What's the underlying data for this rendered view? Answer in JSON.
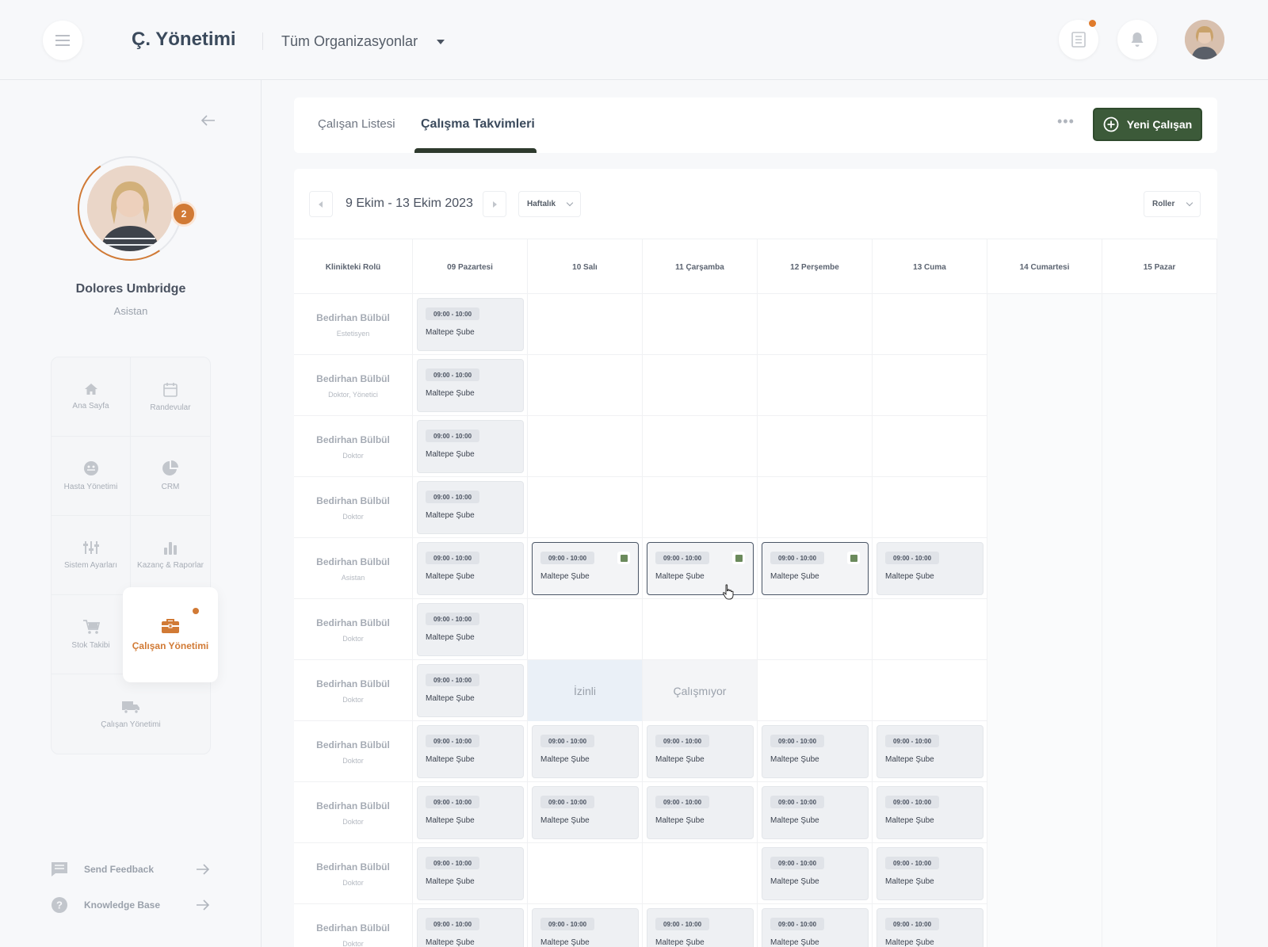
{
  "header": {
    "brand": "Ç. Yönetimi",
    "org": "Tüm Organizasyonlar"
  },
  "sidebar": {
    "profile": {
      "name": "Dolores Umbridge",
      "role": "Asistan",
      "badge": "2"
    },
    "nav": [
      {
        "label": "Ana Sayfa",
        "icon": "home-icon"
      },
      {
        "label": "Randevular",
        "icon": "calendar-icon"
      },
      {
        "label": "Hasta Yönetimi",
        "icon": "patient-icon"
      },
      {
        "label": "CRM",
        "icon": "pie-chart-icon"
      },
      {
        "label": "Sistem Ayarları",
        "icon": "sliders-icon"
      },
      {
        "label": "Kazanç & Raporlar",
        "icon": "bar-chart-icon"
      },
      {
        "label": "Stok Takibi",
        "icon": "cart-icon"
      },
      {
        "label": "Çalışan Yönetimi",
        "icon": "briefcase-icon",
        "active": true
      },
      {
        "label": "Çalışan Yönetimi",
        "icon": "truck-icon"
      }
    ],
    "feedback": "Send Feedback",
    "knowledge": "Knowledge  Base"
  },
  "tabs": {
    "list": "Çalışan Listesi",
    "calendar": "Çalışma Takvimleri",
    "more": "•••",
    "new_button": "Yeni Çalışan"
  },
  "calendar": {
    "range": "9 Ekim - 13 Ekim 2023",
    "view": "Haftalık",
    "roles_filter": "Roller",
    "columns": [
      "Klinikteki Rolü",
      "09 Pazartesi",
      "10 Salı",
      "11 Çarşamba",
      "12 Perşembe",
      "13 Cuma",
      "14 Cumartesi",
      "15 Pazar"
    ],
    "shift_time": "09:00 - 10:00",
    "shift_location": "Maltepe Şube",
    "leave_label": "İzinli",
    "off_label": "Çalışmıyor",
    "rows": [
      {
        "name": "Bedirhan Bülbül",
        "role": "Estetisyen",
        "days": [
          "s",
          "",
          "",
          "",
          ""
        ]
      },
      {
        "name": "Bedirhan Bülbül",
        "role": "Doktor, Yönetici",
        "days": [
          "s",
          "",
          "",
          "",
          ""
        ]
      },
      {
        "name": "Bedirhan Bülbül",
        "role": "Doktor",
        "days": [
          "s",
          "",
          "",
          "",
          ""
        ]
      },
      {
        "name": "Bedirhan Bülbül",
        "role": "Doktor",
        "days": [
          "s",
          "",
          "",
          "",
          ""
        ]
      },
      {
        "name": "Bedirhan Bülbül",
        "role": "Asistan",
        "days": [
          "s",
          "sel",
          "sel",
          "sel",
          "s"
        ]
      },
      {
        "name": "Bedirhan Bülbül",
        "role": "Doktor",
        "days": [
          "s",
          "",
          "",
          "",
          ""
        ]
      },
      {
        "name": "Bedirhan Bülbül",
        "role": "Doktor",
        "days": [
          "s",
          "leave",
          "off",
          "",
          ""
        ]
      },
      {
        "name": "Bedirhan Bülbül",
        "role": "Doktor",
        "days": [
          "s",
          "s",
          "s",
          "s",
          "s"
        ]
      },
      {
        "name": "Bedirhan Bülbül",
        "role": "Doktor",
        "days": [
          "s",
          "s",
          "s",
          "s",
          "s"
        ]
      },
      {
        "name": "Bedirhan Bülbül",
        "role": "Doktor",
        "days": [
          "s",
          "",
          "",
          "s",
          "s"
        ]
      },
      {
        "name": "Bedirhan Bülbül",
        "role": "Doktor",
        "days": [
          "s",
          "s",
          "s",
          "s",
          "s"
        ]
      }
    ]
  },
  "colors": {
    "accent": "#d17a35",
    "primary": "#3c5a39",
    "shift_marker": "#6b8a5c"
  }
}
